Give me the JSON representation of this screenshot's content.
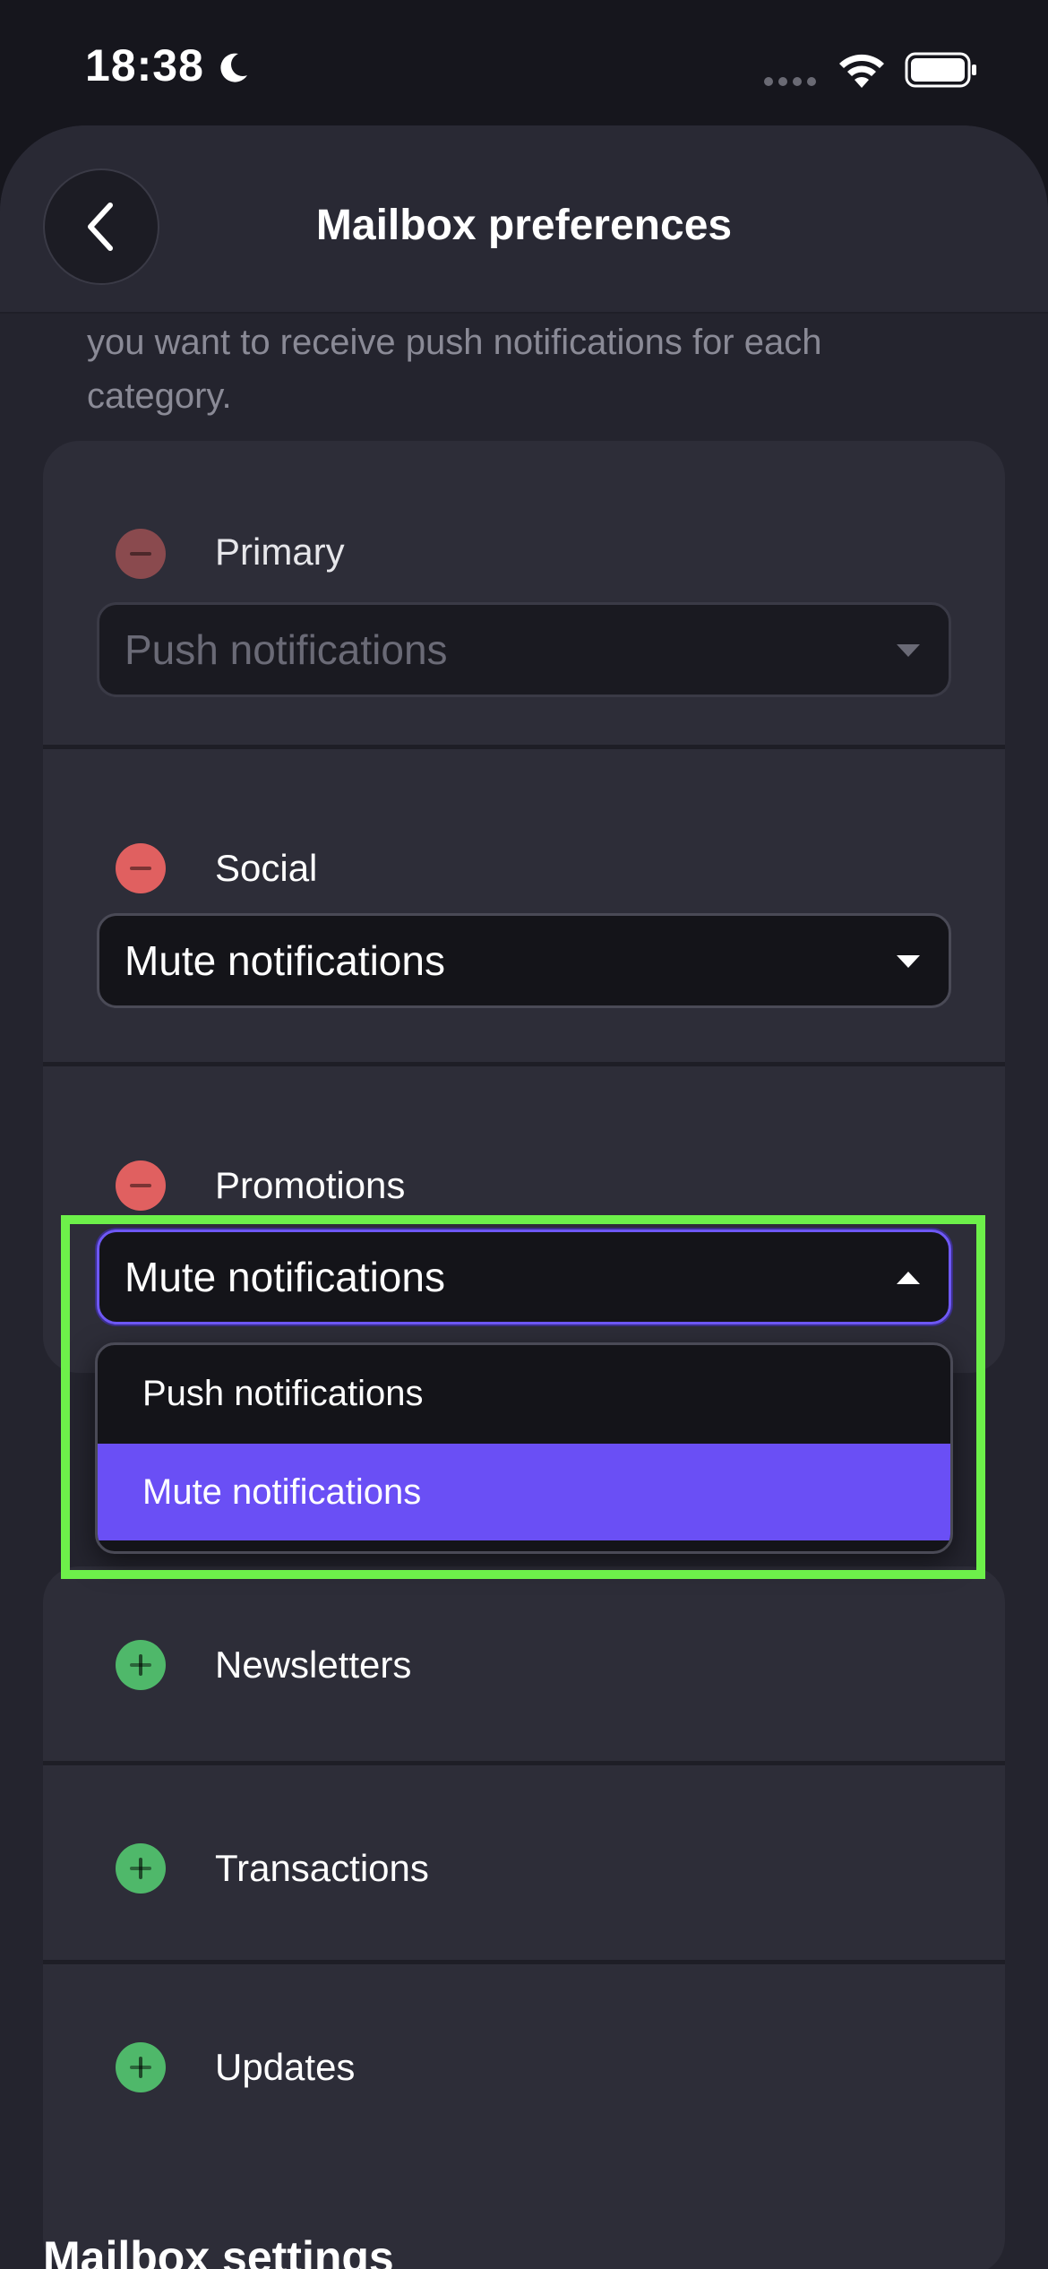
{
  "status_bar": {
    "time": "18:38"
  },
  "header": {
    "title": "Mailbox preferences"
  },
  "description": "you want to receive push notifications for each category.",
  "active_categories": [
    {
      "label": "Primary",
      "select_value": "Push notifications"
    },
    {
      "label": "Social",
      "select_value": "Mute notifications"
    },
    {
      "label": "Promotions",
      "select_value": "Mute notifications"
    }
  ],
  "dropdown": {
    "options": [
      "Push notifications",
      "Mute notifications"
    ],
    "selected": "Mute notifications"
  },
  "inactive_categories": [
    {
      "label": "Newsletters"
    },
    {
      "label": "Transactions"
    },
    {
      "label": "Updates"
    }
  ],
  "next_section_title": "Mailbox settings",
  "colors": {
    "accent": "#6a4ff5",
    "remove": "#e06060",
    "add": "#4fb86a",
    "highlight": "#6df04a"
  }
}
